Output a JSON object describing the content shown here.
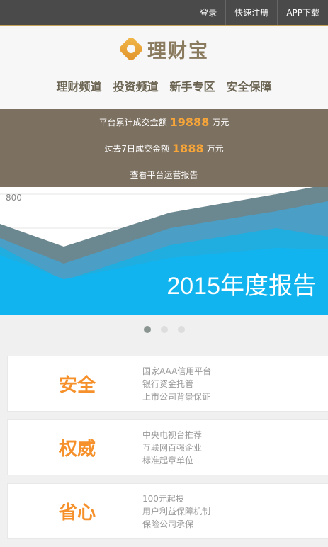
{
  "topbar": {
    "links": [
      {
        "label": "登录"
      },
      {
        "label": "快速注册"
      },
      {
        "label": "APP下载"
      }
    ]
  },
  "header": {
    "logo_text": "理财宝"
  },
  "nav": {
    "items": [
      {
        "label": "理财频道"
      },
      {
        "label": "投资频道"
      },
      {
        "label": "新手专区"
      },
      {
        "label": "安全保障"
      }
    ]
  },
  "stats": {
    "line1_prefix": "平台累计成交金额",
    "line1_value": "19888",
    "line1_unit": "万元",
    "line2_prefix": "过去7日成交金额",
    "line2_value": "1888",
    "line2_unit": "万元",
    "report_link": "查看平台运营报告"
  },
  "banner": {
    "title": "2015年度报告",
    "axis_label": "800"
  },
  "carousel": {
    "active_index": 0,
    "count": 3
  },
  "features": [
    {
      "title": "安全",
      "points": [
        "国家AAA信用平台",
        "银行资金托管",
        "上市公司背景保证"
      ]
    },
    {
      "title": "权威",
      "points": [
        "中央电视台推荐",
        "互联网百强企业",
        "标准起章单位"
      ]
    },
    {
      "title": "省心",
      "points": [
        "100元起投",
        "用户利益保障机制",
        "保险公司承保"
      ]
    }
  ],
  "colors": {
    "topbar_bg": "#4a4a4a",
    "stats_bg": "#7c7060",
    "accent_orange": "#f5902a",
    "banner_blue": "#11b4ee"
  }
}
